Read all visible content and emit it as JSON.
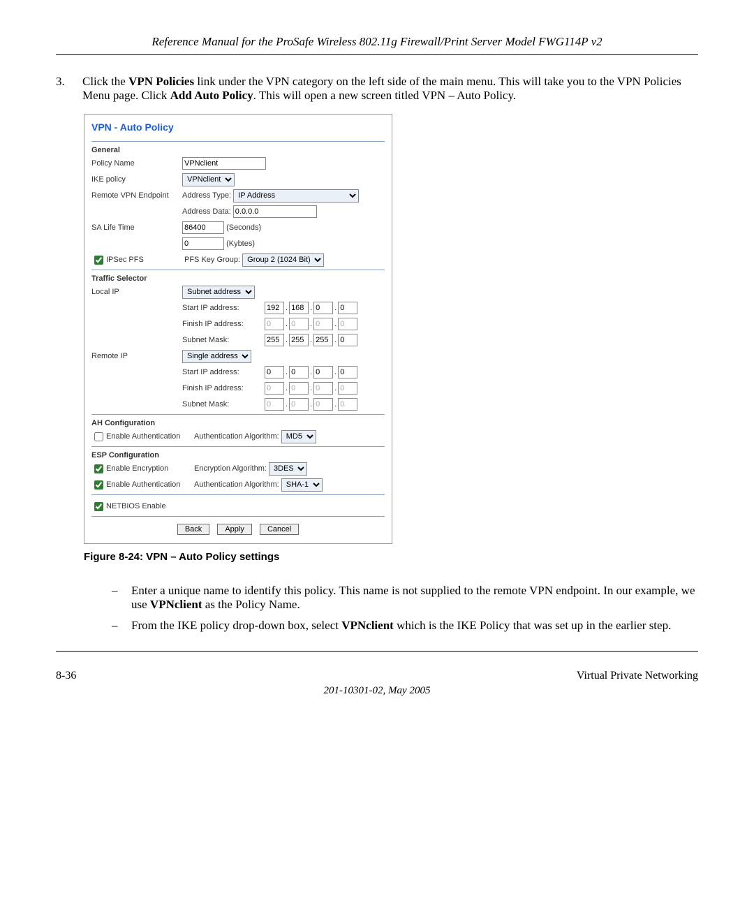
{
  "header": "Reference Manual for the ProSafe Wireless 802.11g  Firewall/Print Server Model FWG114P v2",
  "step": {
    "num": "3.",
    "text_pre": "Click the ",
    "bold1": "VPN Policies",
    "text_mid1": " link under the VPN category on the left side of the main menu. This will take you to the VPN Policies Menu page. Click ",
    "bold2": "Add Auto Policy",
    "text_mid2": ". This will open a new screen titled VPN – Auto Policy."
  },
  "panel": {
    "title": "VPN - Auto Policy",
    "general": {
      "heading": "General",
      "policy_name_lbl": "Policy Name",
      "policy_name_val": "VPNclient",
      "ike_lbl": "IKE policy",
      "ike_val": "VPNclient",
      "remote_lbl": "Remote VPN Endpoint",
      "addr_type_lbl": "Address Type:",
      "addr_type_val": "IP Address",
      "addr_data_lbl": "Address Data:",
      "addr_data_val": "0.0.0.0",
      "sa_lbl": "SA Life Time",
      "sa_sec_val": "86400",
      "sa_sec_unit": "(Seconds)",
      "sa_kb_val": "0",
      "sa_kb_unit": "(Kybtes)",
      "pfs_lbl": "IPSec PFS",
      "pfs_key_lbl": "PFS Key Group:",
      "pfs_key_val": "Group 2 (1024 Bit)"
    },
    "traffic": {
      "heading": "Traffic Selector",
      "local_lbl": "Local IP",
      "local_type": "Subnet address",
      "start_lbl": "Start IP address:",
      "finish_lbl": "Finish IP address:",
      "mask_lbl": "Subnet Mask:",
      "local_start": [
        "192",
        "168",
        "0",
        "0"
      ],
      "local_finish": [
        "0",
        "0",
        "0",
        "0"
      ],
      "local_mask": [
        "255",
        "255",
        "255",
        "0"
      ],
      "remote_lbl": "Remote IP",
      "remote_type": "Single address",
      "remote_start": [
        "0",
        "0",
        "0",
        "0"
      ],
      "remote_finish": [
        "0",
        "0",
        "0",
        "0"
      ],
      "remote_mask": [
        "0",
        "0",
        "0",
        "0"
      ]
    },
    "ah": {
      "heading": "AH Configuration",
      "enable_lbl": "Enable Authentication",
      "algo_lbl": "Authentication Algorithm:",
      "algo_val": "MD5"
    },
    "esp": {
      "heading": "ESP Configuration",
      "enc_lbl": "Enable Encryption",
      "enc_algo_lbl": "Encryption Algorithm:",
      "enc_algo_val": "3DES",
      "auth_lbl": "Enable Authentication",
      "auth_algo_lbl": "Authentication Algorithm:",
      "auth_algo_val": "SHA-1"
    },
    "netbios_lbl": "NETBIOS Enable",
    "buttons": {
      "back": "Back",
      "apply": "Apply",
      "cancel": "Cancel"
    }
  },
  "caption": "Figure 8-24:  VPN – Auto Policy  settings",
  "bullets": [
    {
      "pre": "Enter a unique name to identify this policy. This name is not supplied to the remote VPN endpoint. In our example, we use ",
      "bold": "VPNclient",
      "post": " as the Policy Name."
    },
    {
      "pre": "From the IKE policy drop-down box, select ",
      "bold": "VPNclient",
      "post": " which is the IKE Policy that was set up in the earlier step."
    }
  ],
  "footer": {
    "page": "8-36",
    "section": "Virtual Private Networking",
    "doc": "201-10301-02, May 2005"
  }
}
